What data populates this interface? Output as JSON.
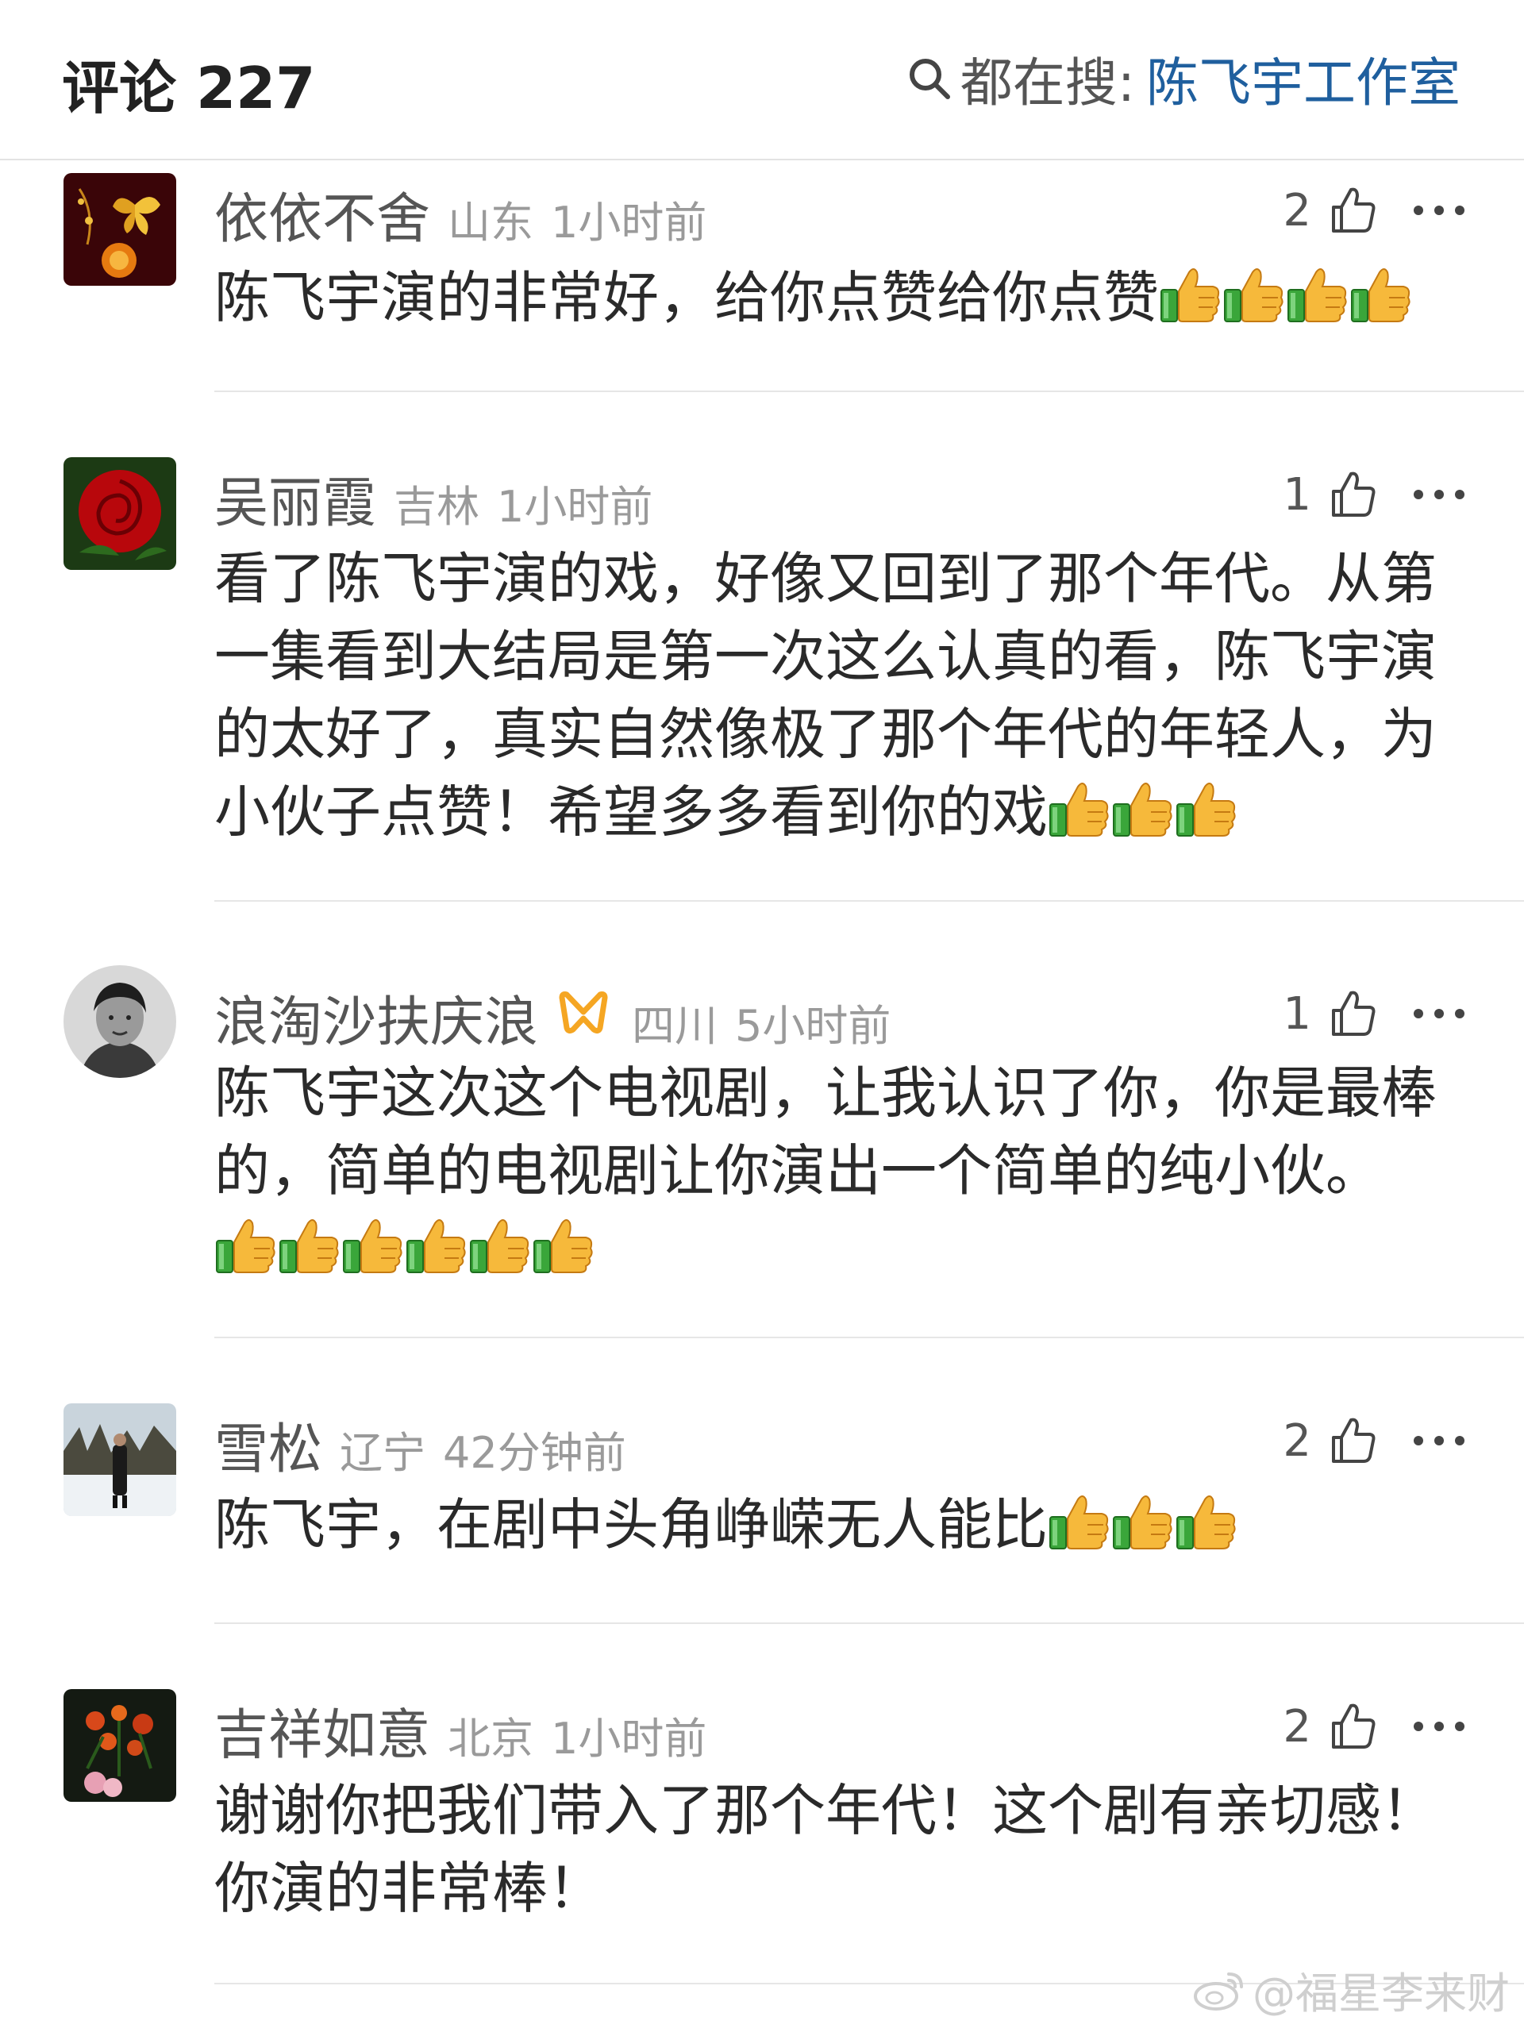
{
  "header": {
    "title": "评论 227",
    "search_prefix": "都在搜:",
    "search_term": "陈飞宇工作室"
  },
  "comments": [
    {
      "username": "依依不舍",
      "region": "山东",
      "time": "1小时前",
      "likes": "2",
      "text": "陈飞宇演的非常好，给你点赞给你点赞",
      "thumbs_emoji_count": 4,
      "avatar": "butterfly-lantern-avatar"
    },
    {
      "username": "吴丽霞",
      "region": "吉林",
      "time": "1小时前",
      "likes": "1",
      "text": "看了陈飞宇演的戏，好像又回到了那个年代。从第一集看到大结局是第一次这么认真的看，陈飞宇演的太好了，真实自然像极了那个年代的年轻人，为小伙子点赞！希望多多看到你的戏",
      "thumbs_emoji_count": 3,
      "avatar": "red-rose-avatar"
    },
    {
      "username": "浪淘沙扶庆浪",
      "region": "四川",
      "time": "5小时前",
      "likes": "1",
      "text": "陈飞宇这次这个电视剧，让我认识了你，你是最棒的，简单的电视剧让你演出一个简单的纯小伙。",
      "thumbs_emoji_count": 6,
      "avatar": "portrait-photo-avatar",
      "badge": "orange-ribbon-badge"
    },
    {
      "username": "雪松",
      "region": "辽宁",
      "time": "42分钟前",
      "likes": "2",
      "text": "陈飞宇，在剧中头角峥嵘无人能比",
      "thumbs_emoji_count": 3,
      "avatar": "snow-scene-avatar"
    },
    {
      "username": "吉祥如意",
      "region": "北京",
      "time": "1小时前",
      "likes": "2",
      "text": "谢谢你把我们带入了那个年代！这个剧有亲切感！你演的非常棒！",
      "thumbs_emoji_count": 0,
      "avatar": "flowers-avatar"
    }
  ],
  "watermark": "@福星李来财",
  "colors": {
    "search_term": "#1f5f9e",
    "meta_gray": "#9a9a9a",
    "badge_orange": "#f5a623"
  }
}
